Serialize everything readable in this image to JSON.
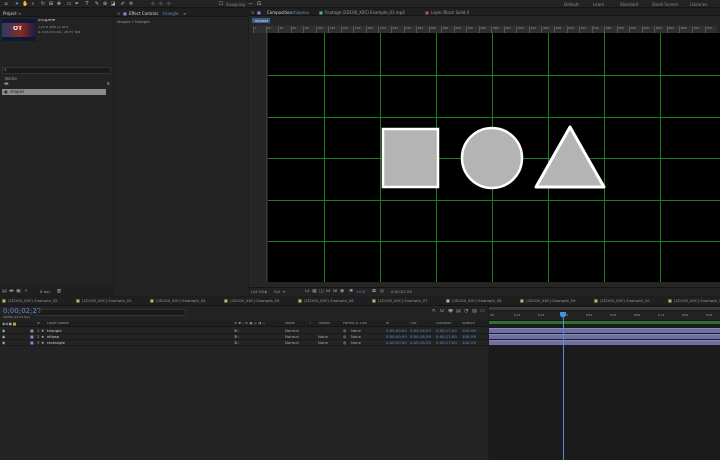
{
  "toolbar": {
    "snapping": "Snapping",
    "workspaces": [
      "Default",
      "Learn",
      "Standard",
      "Small Screen",
      "Libraries"
    ]
  },
  "project": {
    "tab": "Project",
    "comp_name": "shapes",
    "comp_info_1": "720 x 480 (1.00)",
    "comp_info_2": "Δ 0;00;05;00, 29.97 fps",
    "search_placeholder": "",
    "col_name": "Name",
    "items": [
      "shapes"
    ],
    "footer_bpc": "8 bpc"
  },
  "effect_controls": {
    "tab": "Effect Controls",
    "layer": "triangle",
    "breadcrumb": "shapes • triangle"
  },
  "composition": {
    "tab_comp": "Composition",
    "comp_link": "shapes",
    "tab_footage": "Footage (2D100_X0C) Example_01.mp4",
    "tab_layer": "Layer Black Solid 4",
    "flow_tab": "shapes",
    "zoom": "(44.5%)",
    "resolution": "Full",
    "plus": "+0.0",
    "time": "0;00;02;29"
  },
  "ruler_labels": [
    "0",
    "20",
    "40",
    "60",
    "80",
    "100",
    "120",
    "140",
    "160",
    "180",
    "200",
    "220",
    "240",
    "260",
    "280",
    "300",
    "320",
    "340",
    "360",
    "380",
    "400",
    "420",
    "440",
    "460",
    "480",
    "500",
    "520",
    "540",
    "560",
    "580",
    "600",
    "620",
    "640",
    "660",
    "680",
    "700",
    "720"
  ],
  "timeline": {
    "tabs": [
      "(2D100_X0C) Example_02",
      "(2D100_X0C) Example_03",
      "(2D100_X0C) Example_04",
      "(2D100_X0C) Example_05",
      "(2D100_X0C) Example_06",
      "(2D100_X0C) Example_07",
      "(2D100_X0C) Example_08",
      "(2D100_X0C) Example_09",
      "(2D100_X0C) Example_10",
      "(2D100_X0C) Example_11"
    ],
    "timecode": "0;00;02;29",
    "timecode_sub": "00089 (29.97 fps)",
    "headers": {
      "num": "#",
      "layer_name": "Layer Name",
      "mode": "Mode",
      "t": "T",
      "trkmat": "TrkMat",
      "parent": "Parent & Link",
      "in": "In",
      "out": "Out",
      "duration": "Duration",
      "stretch": "Stretch"
    },
    "ruler": [
      "0s",
      "01s",
      "02s",
      "03s",
      "04s",
      "05s",
      "06s",
      "07s",
      "08s",
      "09s"
    ],
    "layers": [
      {
        "num": "1",
        "name": "triangle",
        "mode": "Normal",
        "trkmat": "",
        "parent": "None",
        "in": "0;00;00;00",
        "out": "0;00;16;29",
        "duration": "0;00;17;00",
        "stretch": "100.0%"
      },
      {
        "num": "2",
        "name": "ellipse",
        "mode": "Normal",
        "trkmat": "None",
        "parent": "None",
        "in": "0;00;00;00",
        "out": "0;00;16;29",
        "duration": "0;00;17;00",
        "stretch": "100.0%"
      },
      {
        "num": "3",
        "name": "rectangle",
        "mode": "Normal",
        "trkmat": "None",
        "parent": "None",
        "in": "0;00;00;00",
        "out": "0;00;16;29",
        "duration": "0;00;17;00",
        "stretch": "100.0%"
      }
    ]
  },
  "colors": {
    "accent": "#5d8fd8",
    "shape_fill": "#b4b4b4",
    "grid": "#1e7d1e",
    "playhead": "#4a8fe0"
  }
}
